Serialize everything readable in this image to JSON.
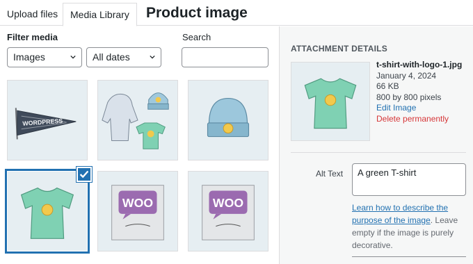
{
  "tabs": {
    "upload": "Upload files",
    "library": "Media Library"
  },
  "modal_title": "Product image",
  "filters": {
    "label": "Filter media",
    "type_selected": "Images",
    "date_selected": "All dates",
    "search_label": "Search",
    "search_value": ""
  },
  "grid": {
    "items": [
      {
        "name": "wordpress-pennant",
        "selected": false
      },
      {
        "name": "hoodie-beanie-tshirt",
        "selected": false
      },
      {
        "name": "beanie",
        "selected": false
      },
      {
        "name": "t-shirt",
        "selected": true
      },
      {
        "name": "woo-single",
        "selected": false
      },
      {
        "name": "woo-album",
        "selected": false
      }
    ]
  },
  "attachment": {
    "heading": "ATTACHMENT DETAILS",
    "filename": "t-shirt-with-logo-1.jpg",
    "date": "January 4, 2024",
    "filesize": "66 KB",
    "dimensions": "800 by 800 pixels",
    "edit_label": "Edit Image",
    "delete_label": "Delete permanently"
  },
  "alt_text": {
    "label": "Alt Text",
    "value": "A green T-shirt",
    "help_link": "Learn how to describe the purpose of the image",
    "help_rest": ". Leave empty if the image is purely decorative."
  },
  "colors": {
    "accent": "#2271b1",
    "danger": "#d63638",
    "tile_bg": "#e6eef2"
  }
}
